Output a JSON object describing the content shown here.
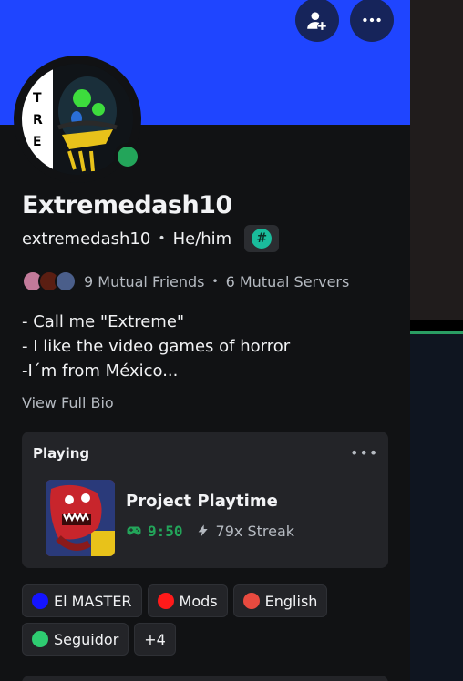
{
  "profile": {
    "display_name": "Extremedash10",
    "username": "extremedash10",
    "pronouns": "He/him",
    "separator": "•",
    "badge_icon": "#",
    "status": "online",
    "banner_color": "#1f45ff",
    "avatar_letters": [
      "T",
      "R",
      "E"
    ]
  },
  "header": {
    "add_friend_icon": "add-friend-icon",
    "more_icon": "more-icon"
  },
  "mutuals": {
    "friends": "9 Mutual Friends",
    "separator": "•",
    "servers": "6 Mutual Servers"
  },
  "bio": {
    "lines": [
      "- Call me \"Extreme\"",
      "- I like the video games of horror",
      "-I´m from México..."
    ],
    "view_full": "View Full Bio"
  },
  "activity": {
    "heading": "Playing",
    "more_label": "•••",
    "game_title": "Project Playtime",
    "elapsed": "9:50",
    "streak": "79x Streak"
  },
  "roles": [
    {
      "label": "El MASTER",
      "color": "#1414ff"
    },
    {
      "label": "Mods",
      "color": "#ff1a1a"
    },
    {
      "label": "English",
      "color": "#e84a3f"
    },
    {
      "label": "Seguidor",
      "color": "#2ecc71"
    }
  ],
  "roles_more": "+4",
  "colors": {
    "online": "#23a55a",
    "accent": "#1abc9c"
  }
}
